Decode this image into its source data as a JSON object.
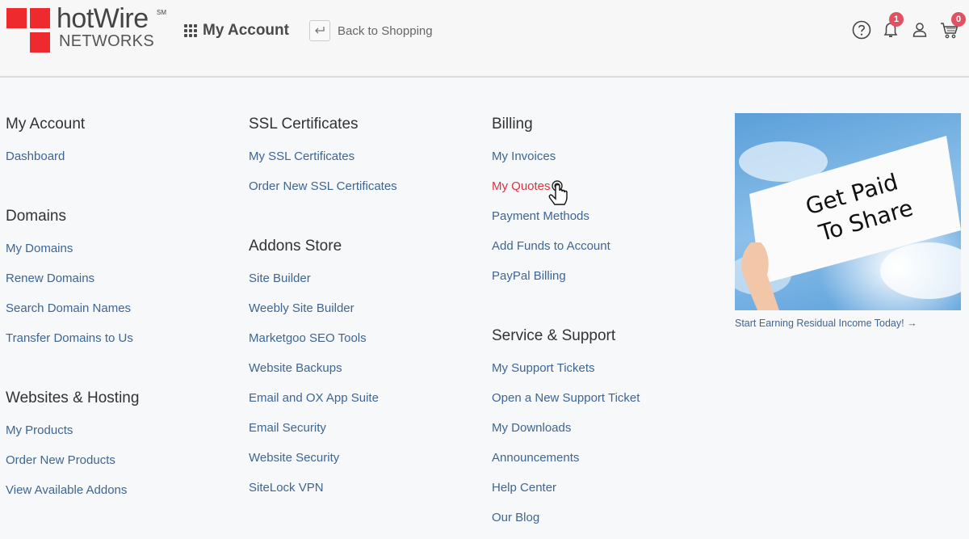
{
  "header": {
    "logo": {
      "brand": "hotWire",
      "sm": "SM",
      "sub": "NETWORKS"
    },
    "app_title": "My Account",
    "back_label": "Back to Shopping",
    "icons": [
      {
        "name": "help-icon",
        "badge": null
      },
      {
        "name": "bell-icon",
        "badge": "1"
      },
      {
        "name": "user-icon",
        "badge": null
      },
      {
        "name": "cart-icon",
        "badge": "0"
      }
    ]
  },
  "columns": [
    {
      "sections": [
        {
          "title": "My Account",
          "links": [
            "Dashboard"
          ]
        },
        {
          "title": "Domains",
          "links": [
            "My Domains",
            "Renew Domains",
            "Search Domain Names",
            "Transfer Domains to Us"
          ]
        },
        {
          "title": "Websites & Hosting",
          "links": [
            "My Products",
            "Order New Products",
            "View Available Addons"
          ]
        }
      ]
    },
    {
      "sections": [
        {
          "title": "SSL Certificates",
          "links": [
            "My SSL Certificates",
            "Order New SSL Certificates"
          ]
        },
        {
          "title": "Addons Store",
          "links": [
            "Site Builder",
            "Weebly Site Builder",
            "Marketgoo SEO Tools",
            "Website Backups",
            "Email and OX App Suite",
            "Email Security",
            "Website Security",
            "SiteLock VPN"
          ]
        }
      ]
    },
    {
      "sections": [
        {
          "title": "Billing",
          "links": [
            "My Invoices",
            "My Quotes",
            "Payment Methods",
            "Add Funds to Account",
            "PayPal Billing"
          ]
        },
        {
          "title": "Service & Support",
          "links": [
            "My Support Tickets",
            "Open a New Support Ticket",
            "My Downloads",
            "Announcements",
            "Help Center",
            "Our Blog"
          ]
        }
      ]
    }
  ],
  "active_link": "My Quotes",
  "promo": {
    "sign_line1": "Get Paid",
    "sign_line2": "To Share",
    "link": "Start Earning Residual Income Today! →"
  },
  "colors": {
    "brand_red": "#ee2a2e",
    "link": "#3d6694",
    "active_link": "#e0323d",
    "badge": "#e05262"
  }
}
